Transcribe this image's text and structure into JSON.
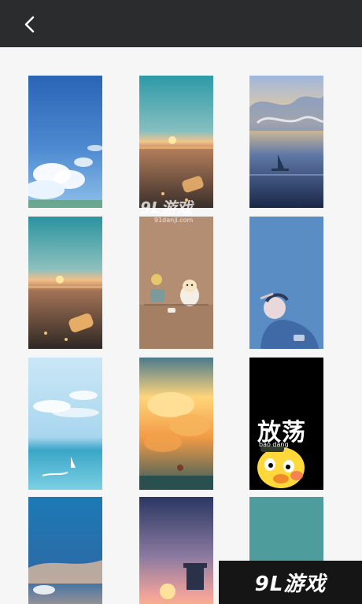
{
  "header": {
    "back_icon": "chevron-left-icon",
    "background_color": "#2b2c2e"
  },
  "wallpapers": [
    {
      "id": "sky-clouds-blue",
      "colors": [
        "#2f6fbe",
        "#7fb3e2",
        "#ffffff"
      ]
    },
    {
      "id": "beach-sunset-bottle",
      "colors": [
        "#3b9aa6",
        "#e9a870",
        "#3a3330"
      ]
    },
    {
      "id": "stormy-sky-boat",
      "colors": [
        "#9bb8dd",
        "#f1c98e",
        "#1d2b4d"
      ]
    },
    {
      "id": "beach-sunset-bottle-2",
      "colors": [
        "#3a96a2",
        "#e3a46a",
        "#2f2a26"
      ]
    },
    {
      "id": "cats-tea-illustration",
      "colors": [
        "#b18c70",
        "#8d6b52",
        "#e4d6c0"
      ]
    },
    {
      "id": "girl-hoodie-blue",
      "colors": [
        "#5a8cc4",
        "#3c6aa5",
        "#d8d8e8"
      ]
    },
    {
      "id": "sea-sailboat",
      "colors": [
        "#bfe2f4",
        "#3da7c8",
        "#ffffff"
      ]
    },
    {
      "id": "sunset-clouds-orange",
      "colors": [
        "#ffc55e",
        "#f18a3a",
        "#3a6a78"
      ]
    },
    {
      "id": "duck-text-black",
      "colors": [
        "#000000",
        "#ffd93b",
        "#ffffff"
      ],
      "text": "放荡",
      "subtext": "bāo dàng"
    },
    {
      "id": "blue-sea-sky",
      "colors": [
        "#1c78b4",
        "#2a5c9a",
        "#f4b58a"
      ]
    },
    {
      "id": "dusk-sunset-gradient",
      "colors": [
        "#2c3a64",
        "#f1a29a",
        "#f7d36a"
      ]
    },
    {
      "id": "teal-plain",
      "colors": [
        "#4f9c9c",
        "#4f9c9c",
        "#4f9c9c"
      ]
    }
  ],
  "watermark": {
    "center_main": "9L游戏",
    "center_sub": "91danji.com",
    "corner": "9L游戏"
  }
}
